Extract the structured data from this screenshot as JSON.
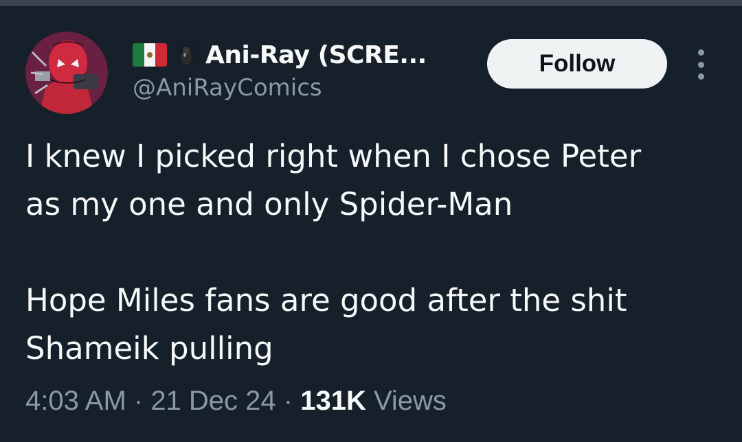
{
  "author": {
    "display_name": "Ani-Ray (SCRE...",
    "handle": "@AniRayComics",
    "badges": [
      "mexico-flag-icon",
      "spider-icon"
    ]
  },
  "follow_label": "Follow",
  "tweet": {
    "lines": [
      "I knew I picked right when I chose Peter",
      "as my one and only Spider-Man",
      "Hope Miles fans are good after the shit",
      "Shameik pulling"
    ]
  },
  "meta": {
    "time": "4:03 AM",
    "sep1": " · ",
    "date": "21 Dec 24",
    "sep2": " · ",
    "views_count": "131K",
    "views_label": " Views"
  },
  "colors": {
    "background": "#15202b",
    "text": "#f7f9f9",
    "secondary": "#8b98a5",
    "button_bg": "#eff3f4"
  }
}
